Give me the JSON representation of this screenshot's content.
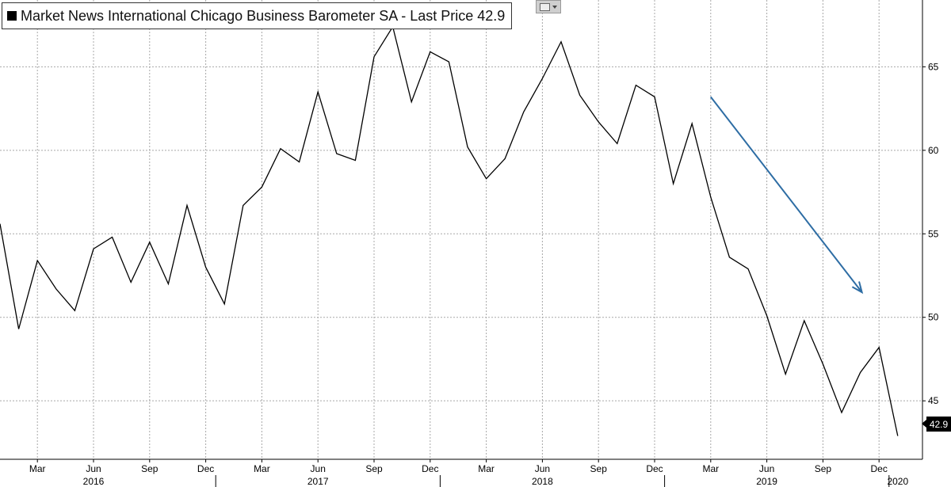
{
  "legend": {
    "label": "Market News International Chicago Business Barometer SA - Last Price 42.9"
  },
  "last_value_label": "42.9",
  "colors": {
    "line": "#000000",
    "arrow": "#2e6da4",
    "grid": "#a8a8a8"
  },
  "chart_data": {
    "type": "line",
    "title": "Market News International Chicago Business Barometer SA - Last Price 42.9",
    "xlabel": "",
    "ylabel": "",
    "ylim": [
      41.5,
      69
    ],
    "y_ticks": [
      45,
      50,
      55,
      60,
      65
    ],
    "x": [
      "2016-01",
      "2016-02",
      "2016-03",
      "2016-04",
      "2016-05",
      "2016-06",
      "2016-07",
      "2016-08",
      "2016-09",
      "2016-10",
      "2016-11",
      "2016-12",
      "2017-01",
      "2017-02",
      "2017-03",
      "2017-04",
      "2017-05",
      "2017-06",
      "2017-07",
      "2017-08",
      "2017-09",
      "2017-10",
      "2017-11",
      "2017-12",
      "2018-01",
      "2018-02",
      "2018-03",
      "2018-04",
      "2018-05",
      "2018-06",
      "2018-07",
      "2018-08",
      "2018-09",
      "2018-10",
      "2018-11",
      "2018-12",
      "2019-01",
      "2019-02",
      "2019-03",
      "2019-04",
      "2019-05",
      "2019-06",
      "2019-07",
      "2019-08",
      "2019-09",
      "2019-10",
      "2019-11",
      "2019-12",
      "2020-01"
    ],
    "series": [
      {
        "values": [
          55.6,
          49.3,
          53.4,
          51.7,
          50.4,
          54.1,
          54.8,
          52.1,
          54.5,
          52.0,
          56.7,
          53.0,
          50.8,
          56.7,
          57.8,
          60.1,
          59.3,
          63.5,
          59.8,
          59.4,
          65.6,
          67.4,
          62.9,
          65.9,
          65.3,
          60.2,
          58.3,
          59.5,
          62.3,
          64.3,
          66.5,
          63.3,
          61.7,
          60.4,
          63.9,
          63.2,
          58.0,
          61.6,
          57.2,
          53.6,
          52.9,
          50.1,
          46.6,
          49.8,
          47.2,
          44.3,
          46.7,
          48.2,
          42.9
        ]
      }
    ],
    "x_tick_labels": [
      {
        "date": "2016-03",
        "label": "Mar"
      },
      {
        "date": "2016-06",
        "label": "Jun"
      },
      {
        "date": "2016-09",
        "label": "Sep"
      },
      {
        "date": "2016-12",
        "label": "Dec"
      },
      {
        "date": "2017-03",
        "label": "Mar"
      },
      {
        "date": "2017-06",
        "label": "Jun"
      },
      {
        "date": "2017-09",
        "label": "Sep"
      },
      {
        "date": "2017-12",
        "label": "Dec"
      },
      {
        "date": "2018-03",
        "label": "Mar"
      },
      {
        "date": "2018-06",
        "label": "Jun"
      },
      {
        "date": "2018-09",
        "label": "Sep"
      },
      {
        "date": "2018-12",
        "label": "Dec"
      },
      {
        "date": "2019-03",
        "label": "Mar"
      },
      {
        "date": "2019-06",
        "label": "Jun"
      },
      {
        "date": "2019-09",
        "label": "Sep"
      },
      {
        "date": "2019-12",
        "label": "Dec"
      }
    ],
    "year_labels": [
      {
        "date": "2016-06",
        "label": "2016"
      },
      {
        "date": "2017-06",
        "label": "2017"
      },
      {
        "date": "2018-06",
        "label": "2018"
      },
      {
        "date": "2019-06",
        "label": "2019"
      },
      {
        "date": "2020-01",
        "label": "2020"
      }
    ],
    "year_boundaries": [
      "2017-01",
      "2018-01",
      "2019-01",
      "2020-01"
    ],
    "trend_arrow": {
      "from": [
        "2019-03",
        63.2
      ],
      "to": [
        "2019-11",
        51.5
      ]
    },
    "grid": true,
    "legend_position": "top-left"
  }
}
